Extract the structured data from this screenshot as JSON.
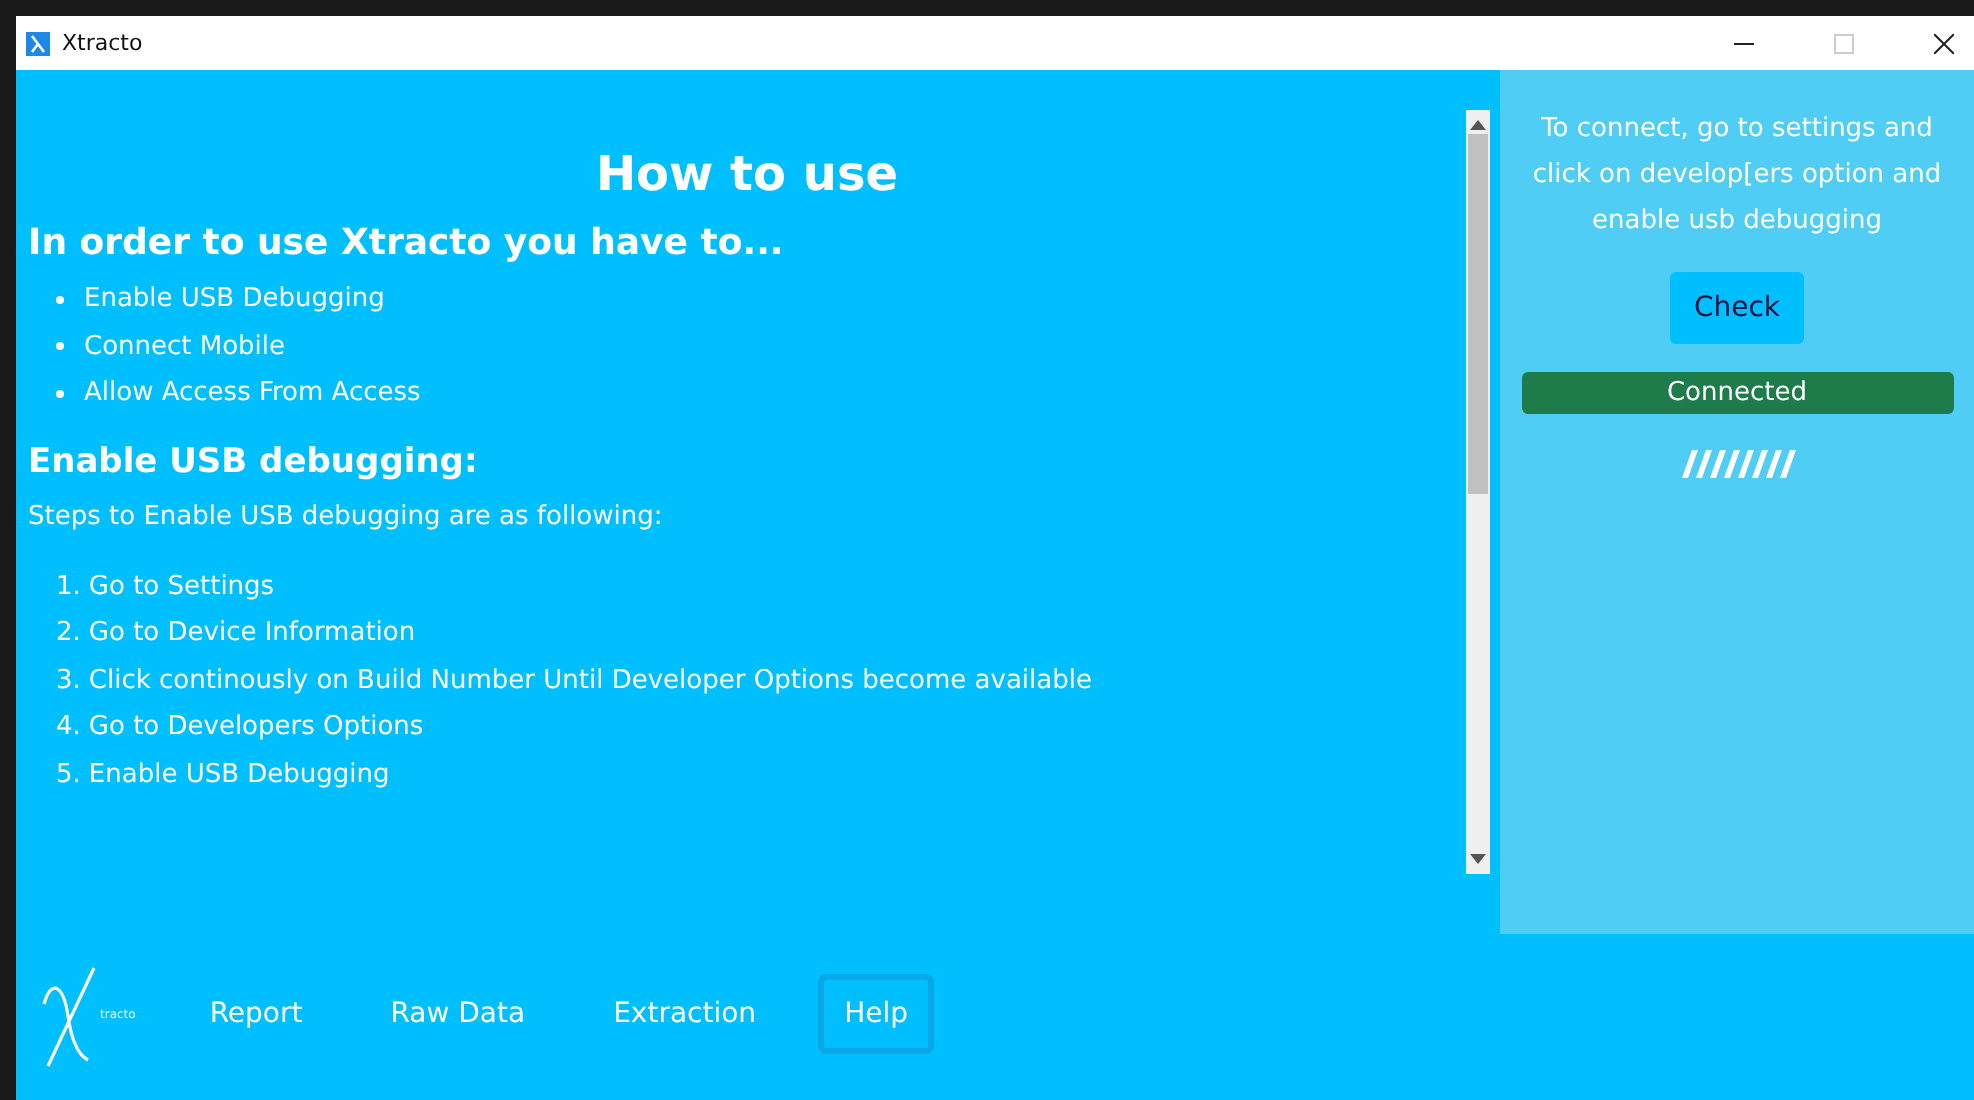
{
  "window": {
    "title": "Xtracto"
  },
  "help": {
    "title": "How to use",
    "heading": "In order to use Xtracto you have to...",
    "requirements": [
      "Enable USB Debugging",
      "Connect Mobile",
      "Allow Access From Access"
    ],
    "section_heading": "Enable USB debugging:",
    "intro": "Steps to Enable USB debugging are as following:",
    "steps": [
      {
        "number": "1.",
        "text": "Go to Settings"
      },
      {
        "number": "2.",
        "text": "Go to Device Information"
      },
      {
        "number": "3.",
        "text": "Click continously on Build Number Until Developer Options become available"
      },
      {
        "number": "4.",
        "text": "Go to Developers Options"
      },
      {
        "number": "5.",
        "text": "Enable USB Debugging"
      }
    ]
  },
  "side_panel": {
    "instructions": "To connect, go to settings and click on develop[ers option and enable usb debugging",
    "check_button": "Check",
    "status": "Connected"
  },
  "nav": {
    "logo_text": "tracto",
    "tabs": [
      {
        "label": "Report",
        "selected": false
      },
      {
        "label": "Raw Data",
        "selected": false
      },
      {
        "label": "Extraction",
        "selected": false
      },
      {
        "label": "Help",
        "selected": true
      }
    ]
  }
}
